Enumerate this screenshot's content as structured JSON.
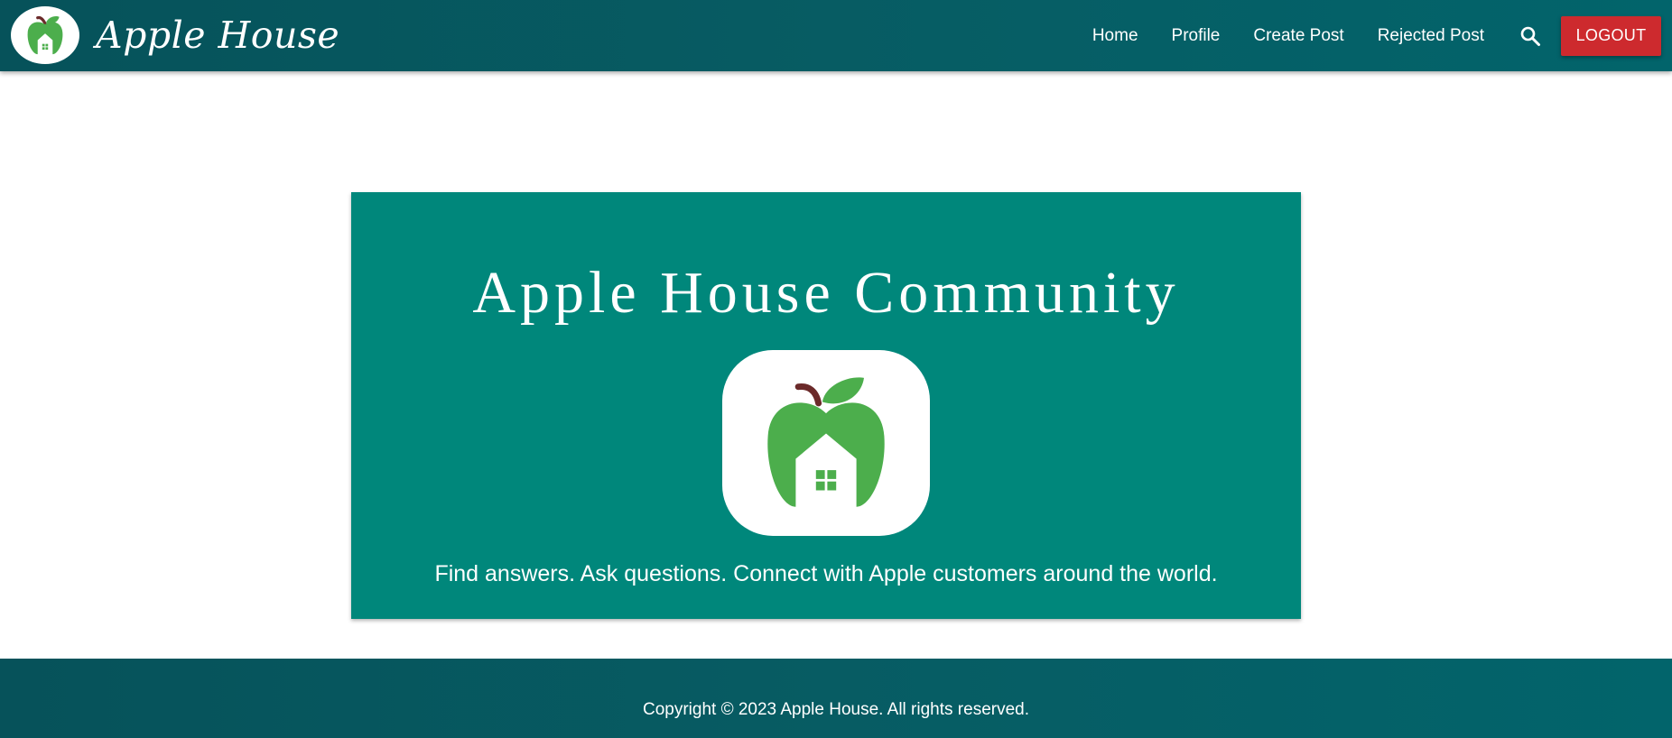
{
  "brand": {
    "title": "Apple House",
    "logo_icon": "apple-house-logo-icon"
  },
  "nav": {
    "links": [
      {
        "label": "Home"
      },
      {
        "label": "Profile"
      },
      {
        "label": "Create Post"
      },
      {
        "label": "Rejected Post"
      }
    ],
    "search_icon": "search-icon",
    "logout_label": "LOGOUT"
  },
  "hero": {
    "title": "Apple House Community",
    "logo_icon": "apple-house-logo-icon",
    "tagline": "Find answers. Ask questions. Connect with Apple customers around the world."
  },
  "footer": {
    "copyright": "Copyright © 2023 Apple House. All rights reserved."
  },
  "colors": {
    "navbar": "#075c63",
    "hero_background": "#00877b",
    "logout_button": "#cd2a2e",
    "apple_green": "#4cae4c",
    "stem": "#6b2a2a"
  }
}
